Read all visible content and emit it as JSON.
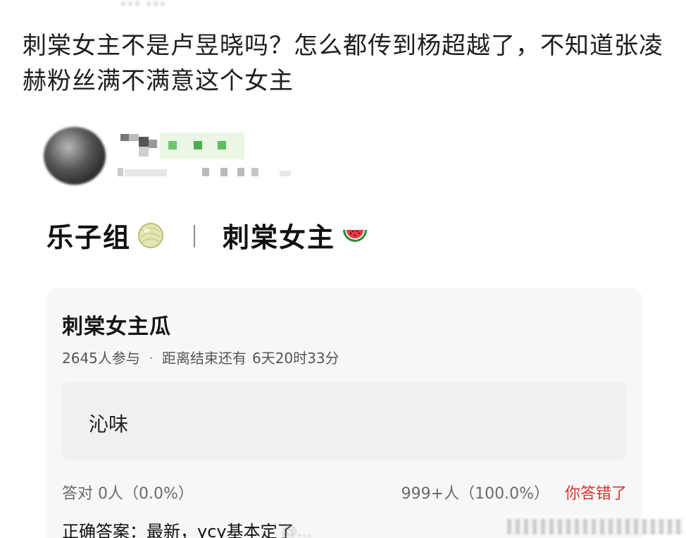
{
  "header": {
    "cutoff_text": "……"
  },
  "post": {
    "text": "刺棠女主不是卢昱晓吗？怎么都传到杨超越了，不知道张凌赫粉丝满不满意这个女主"
  },
  "repost": {
    "title_left": "乐子组",
    "separator": "｜",
    "title_right": "刺棠女主",
    "left_icon": "melon-icon",
    "right_icon": "watermelon-icon"
  },
  "poll": {
    "title": "刺棠女主瓜",
    "participants": "2645人参与",
    "meta_dot": "·",
    "time_label": "距离结束还有",
    "time_left": "6天20时33分",
    "option": "沁味",
    "correct_stats": "答对  0人（0.0%）",
    "wrong_stats": "999+人（100.0%）",
    "wrong_label": "你答错了",
    "answer": "正确答案：最新，ycy基本定了"
  },
  "watermark": {
    "text": "@..."
  },
  "colors": {
    "accent_red": "#d8342b",
    "card_bg": "#f7f7f7",
    "option_bg": "#f0f0f0"
  }
}
